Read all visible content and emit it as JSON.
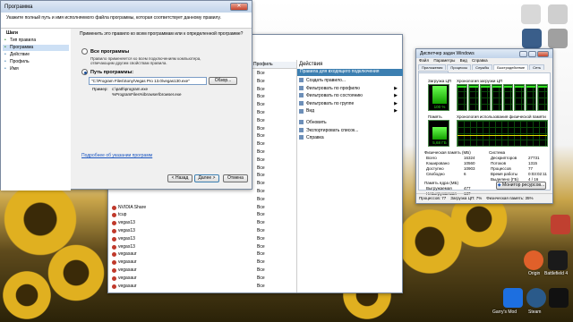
{
  "colors": {
    "accent": "#3c7fb1",
    "graph_green": "#2fe01e",
    "title_blue": "#c2d4ea"
  },
  "dialog": {
    "title": "Программа",
    "header_text": "Укажите полный путь и имя исполняемого файла программы, которая соответствует данному правилу.",
    "steps_title": "Шаги",
    "steps": [
      "Тип правила",
      "Программа",
      "Действие",
      "Профиль",
      "Имя"
    ],
    "question": "Применить это правило ко всем программам или к определенной программе?",
    "option_all": "Все программы",
    "option_all_desc": "Правило применяется ко всем подключениям компьютера, отвечающим другим свойствам правила.",
    "option_path": "Путь программы:",
    "path_value": "\"C:\\Program Files\\Sony\\Vegas Pro 13.0\\vegas130.exe\"",
    "browse": "Обзор...",
    "example_label": "Пример:",
    "example_lines": [
      "c:\\path\\program.exe",
      "%ProgramFiles%\\browser\\browser.exe"
    ],
    "more_link": "Подробнее об указании программ",
    "back": "< Назад",
    "next": "Далее >",
    "cancel": "Отмена"
  },
  "firewall": {
    "col_profile": "Профиль",
    "rows": [
      {
        "name": "",
        "profile": "Все"
      },
      {
        "name": "",
        "profile": "Все"
      },
      {
        "name": "",
        "profile": "Все"
      },
      {
        "name": "",
        "profile": "Все"
      },
      {
        "name": "",
        "profile": "Все"
      },
      {
        "name": "",
        "profile": "Все"
      },
      {
        "name": "",
        "profile": "Все"
      },
      {
        "name": "",
        "profile": "Все"
      },
      {
        "name": "",
        "profile": "Все"
      },
      {
        "name": "",
        "profile": "Все"
      },
      {
        "name": "",
        "profile": "Все"
      },
      {
        "name": "",
        "profile": "Все"
      },
      {
        "name": "",
        "profile": "Все"
      },
      {
        "name": "",
        "profile": "Все"
      },
      {
        "name": "",
        "profile": "Все"
      },
      {
        "name": "",
        "profile": "Все"
      },
      {
        "name": "",
        "profile": "Все"
      },
      {
        "name": "NVIDIA Share",
        "profile": "Все"
      },
      {
        "name": "tcup",
        "profile": "Все"
      },
      {
        "name": "vegas13",
        "profile": "Все"
      },
      {
        "name": "vegas13",
        "profile": "Все"
      },
      {
        "name": "vegas13",
        "profile": "Все"
      },
      {
        "name": "vegas13",
        "profile": "Все"
      },
      {
        "name": "vegasaur",
        "profile": "Все"
      },
      {
        "name": "vegasaur",
        "profile": "Все"
      },
      {
        "name": "vegasaur",
        "profile": "Все"
      },
      {
        "name": "vegasaur",
        "profile": "Все"
      },
      {
        "name": "vegasaur",
        "profile": "Все"
      }
    ],
    "actions_title": "Действия",
    "actions_group": "Правила для входящего подключения",
    "actions": [
      "Создать правило...",
      "Фильтровать по профилю",
      "Фильтровать по состоянию",
      "Фильтровать по группе",
      "Вид",
      "Обновить",
      "Экспортировать список...",
      "Справка"
    ]
  },
  "taskmgr": {
    "title": "Диспетчер задач Windows",
    "menu": [
      "Файл",
      "Параметры",
      "Вид",
      "Справка"
    ],
    "tabs": [
      "Приложения",
      "Процессы",
      "Службы",
      "Быстродействие",
      "Сеть",
      "Пользователи"
    ],
    "cpu_label": "Загрузка ЦП",
    "cpu_value": "100 %",
    "cpu_history_label": "Хронология загрузки ЦП",
    "cpu_cores": [
      100,
      100,
      100,
      100,
      100,
      100,
      100,
      100
    ],
    "mem_label": "Память",
    "mem_value": "5,68 ГБ",
    "mem_history_label": "Хронология использования физической памяти",
    "phys_title": "Физическая память (МБ)",
    "phys": [
      [
        "Всего",
        "16324"
      ],
      [
        "Кэшировано",
        "10560"
      ],
      [
        "Доступно",
        "10903"
      ],
      [
        "Свободно",
        "6"
      ]
    ],
    "kernel_title": "Память ядра (МБ)",
    "kernel": [
      [
        "Выгружаемая",
        "477"
      ],
      [
        "Невыгружаемая",
        "137"
      ]
    ],
    "system_title": "Система",
    "system": [
      [
        "Дескрипторов",
        "27731"
      ],
      [
        "Потоков",
        "1315"
      ],
      [
        "Процессов",
        "77"
      ],
      [
        "Время работы",
        "0:03:02:11"
      ],
      [
        "Выделено (ГБ)",
        "4 / 16"
      ]
    ],
    "resmon_button": "Монитор ресурсов...",
    "status": [
      "Процессов: 77",
      "Загрузка ЦП: 7%",
      "Физическая память: 35%"
    ]
  },
  "desktop": {
    "icons_right": [
      "",
      "",
      "",
      "",
      "",
      ""
    ],
    "taskbar_labels": [
      "Garry's Mod",
      "Steam",
      "Battlefield 4",
      "Battlefield 4"
    ],
    "labels": [
      "Garry's Mod",
      "Steam",
      "Origin",
      "Battlefield 4"
    ]
  }
}
